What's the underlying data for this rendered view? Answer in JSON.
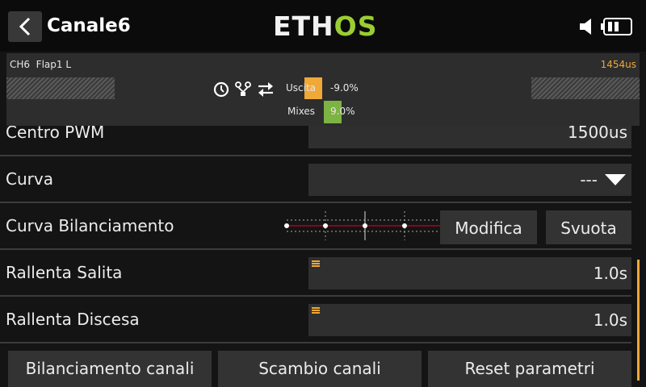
{
  "header": {
    "title": "Canale6",
    "logo_main": "ETH",
    "logo_accent": "OS"
  },
  "monitor": {
    "channel_label": "CH6  Flap1 L",
    "pulse_value": "1454us",
    "output_label": "Uscita",
    "output_value": "-9.0%",
    "mixes_label": "Mixes",
    "mixes_value": "9.0%"
  },
  "rows": {
    "pwm_center": {
      "label": "Centro PWM",
      "value": "1500us"
    },
    "curve": {
      "label": "Curva",
      "value": "---"
    },
    "balance_curve": {
      "label": "Curva Bilanciamento",
      "edit_label": "Modifica",
      "clear_label": "Svuota"
    },
    "slow_up": {
      "label": "Rallenta Salita",
      "value": "1.0s"
    },
    "slow_down": {
      "label": "Rallenta Discesa",
      "value": "1.0s"
    }
  },
  "bottom_buttons": {
    "balance": "Bilanciamento canali",
    "swap": "Scambio canali",
    "reset": "Reset parametri"
  },
  "colors": {
    "accent_orange": "#f0a836",
    "accent_green": "#7cb342",
    "logo_green": "#9acd32"
  },
  "icons": [
    "back-arrow-icon",
    "speaker-icon",
    "battery-icon",
    "clock-icon",
    "tree-icon",
    "swap-icon",
    "chevron-down-icon",
    "menu-lines-icon"
  ]
}
